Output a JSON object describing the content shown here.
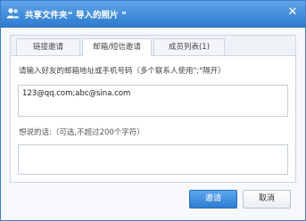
{
  "dialog": {
    "title": "共享文件夹“ 导入的照片 ”",
    "close_symbol": "✕",
    "icons": {
      "title": "users-icon",
      "close": "close-icon"
    }
  },
  "tabs": [
    {
      "label": "链接邀请",
      "active": false
    },
    {
      "label": "邮箱/短信邀请",
      "active": true
    },
    {
      "label": "成员列表(1)",
      "active": false
    }
  ],
  "form": {
    "instruction": "请输入好友的邮箱地址或手机号码（多个联系人使用\";\"隔开）",
    "emails_value": "123@qq.com;abc@sina.com",
    "message_label": "想说的话:（可选,不超过200个字符）",
    "message_value": ""
  },
  "buttons": {
    "invite_label": "邀请",
    "cancel_label": "取消"
  },
  "colors": {
    "titlebar": "#3d8ddb",
    "primary_button": "#3f8fe0"
  }
}
